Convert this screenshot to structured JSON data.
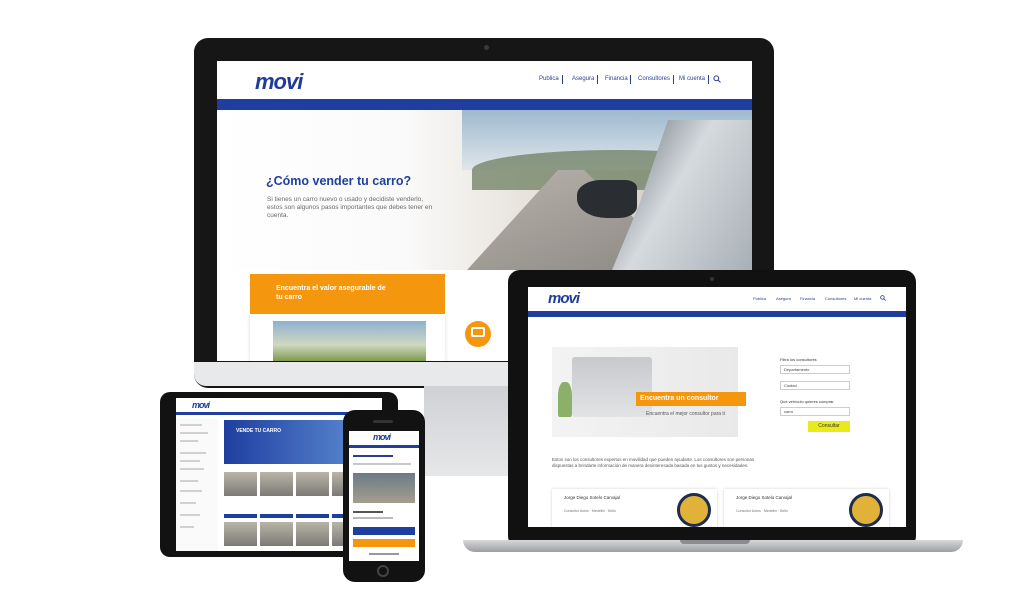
{
  "desktop": {
    "logo": "movi",
    "nav": [
      "Publica",
      "Asegura",
      "Financia",
      "Consultores",
      "Mi cuenta"
    ],
    "hero_title": "¿Cómo vender tu carro?",
    "hero_text": "Si tienes un carro nuevo o usado y decidiste venderlo, estos son algunos pasos importantes que debes tener en cuenta.",
    "card_label": "Encuentra el valor asegurable de tu carro"
  },
  "laptop": {
    "logo": "movi",
    "nav": [
      "Publica",
      "Asegura",
      "Financia",
      "Consultores",
      "Mi cuenta"
    ],
    "banner_title": "Encuentra un consultor",
    "banner_sub": "Encuentra el mejor consultor para ti",
    "form": {
      "label1": "Filtrá los consultores",
      "dept": "Departamento",
      "city": "Ciudad",
      "label2": "Qué vehículo quieres comprar",
      "vehicle": "carro",
      "button": "Consultar"
    },
    "paragraph": "Estos son los consultores expertos en movilidad que pueden ayudarte. Los consultores son personas dispuestas a brindarte información de manera desinteresada basada en tus gustos y necesidades.",
    "cards": [
      {
        "name": "Jorge Diego Sotelo Carvajal",
        "info": "Consultor Autos · Medellín · Bello"
      },
      {
        "name": "Jorge Diego Sotelo Carvajal",
        "info": "Consultor Autos · Medellín · Bello"
      }
    ]
  },
  "tablet": {
    "logo": "movi",
    "banner": "VENDE TU CARRO"
  },
  "phone": {
    "logo": "movi"
  },
  "colors": {
    "brand_blue": "#1e3fa0",
    "accent_orange": "#f4970f",
    "button_yellow": "#eaea1a"
  }
}
